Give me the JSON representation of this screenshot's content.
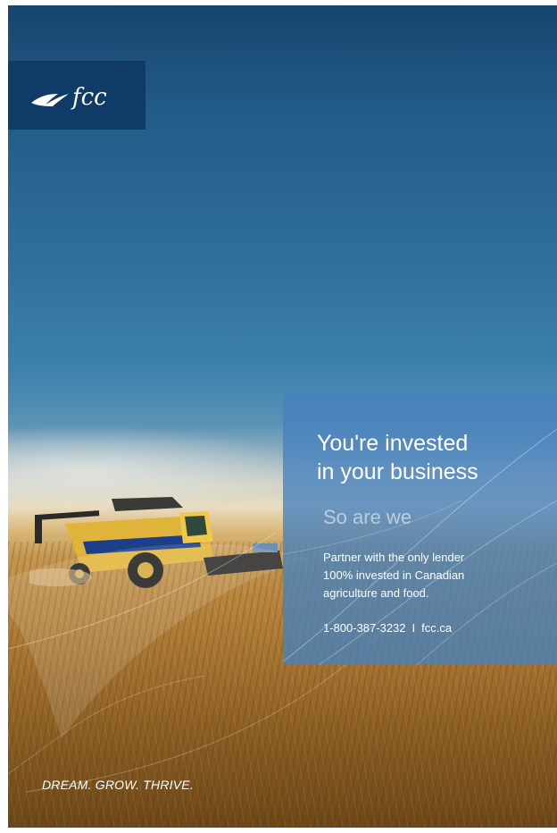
{
  "logo": {
    "text": "fcc"
  },
  "panel": {
    "headline": [
      "You're invested",
      "in your business"
    ],
    "subhead": "So are we",
    "body": [
      "Partner with the only lender",
      "100% invested in Canadian",
      "agriculture and food."
    ],
    "phone": "1-800-387-3232",
    "separator": "I",
    "website": "fcc.ca"
  },
  "tagline": "DREAM. GROW. THRIVE.",
  "colors": {
    "logo_background": "#0f3b67",
    "panel_background": "#4682be",
    "combine_body": "#e0b43a"
  },
  "icons": [
    "fcc-logo-mark",
    "combine-harvester-image"
  ]
}
